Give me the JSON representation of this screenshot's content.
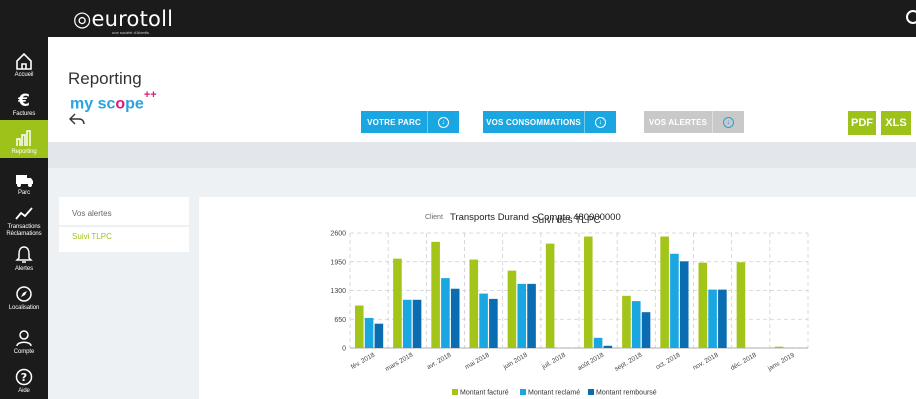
{
  "header": {
    "logo": "eurotoll",
    "logo_sub": "une société d'Abertis"
  },
  "sidebar": {
    "items": [
      {
        "label": "Accueil",
        "icon": "home-icon"
      },
      {
        "label": "Factures",
        "icon": "euro-icon"
      },
      {
        "label": "Reporting",
        "icon": "bar-chart-icon"
      },
      {
        "label": "Parc",
        "icon": "truck-icon"
      },
      {
        "label": "Transactions Réclamations",
        "icon": "trend-line-icon"
      },
      {
        "label": "Alertes",
        "icon": "bell-icon"
      },
      {
        "label": "Localisation",
        "icon": "compass-icon"
      },
      {
        "label": "Compte",
        "icon": "user-icon"
      },
      {
        "label": "Aide",
        "icon": "help-icon"
      }
    ],
    "active_index": 2
  },
  "page": {
    "title": "Reporting",
    "brand_a": "my sc",
    "brand_o": "o",
    "brand_b": "pe",
    "brand_plus": "++"
  },
  "tabs": {
    "parc": "VOTRE PARC",
    "conso": "VOS CONSOMMATIONS",
    "alertes": "VOS ALERTES"
  },
  "export": {
    "pdf": "PDF",
    "xls": "XLS"
  },
  "left_menu": {
    "item1": "Vos alertes",
    "item2": "Suivi TLPC"
  },
  "client": {
    "label": "Client",
    "value": "Transports Durand - Compte 480000000"
  },
  "colors": {
    "green": "#9dc31b",
    "blue": "#1aa6e0",
    "dark_blue": "#0a6db1",
    "dark": "#1b1b1b"
  },
  "chart_data": {
    "type": "bar",
    "title": "Suivi des TLPC",
    "categories": [
      "fév. 2018",
      "mars 2018",
      "avr. 2018",
      "mai 2018",
      "juin 2018",
      "juil. 2018",
      "août 2018",
      "sept. 2018",
      "oct. 2018",
      "nov. 2018",
      "déc. 2018",
      "janv. 2019"
    ],
    "series": [
      {
        "name": "Montant facturé",
        "color": "#a3c51a",
        "values": [
          960,
          2020,
          2400,
          2000,
          1750,
          2360,
          2520,
          1180,
          2520,
          1930,
          1940,
          30
        ]
      },
      {
        "name": "Montant reclamé",
        "color": "#1aa6e0",
        "values": [
          680,
          1090,
          1580,
          1230,
          1450,
          0,
          230,
          1060,
          2130,
          1320,
          0,
          0
        ]
      },
      {
        "name": "Montant remboursé",
        "color": "#0a6db1",
        "values": [
          550,
          1090,
          1340,
          1110,
          1450,
          0,
          50,
          810,
          1960,
          1320,
          0,
          0
        ]
      }
    ],
    "yticks": [
      "0",
      "650",
      "1300",
      "1950",
      "2600"
    ],
    "ylim": [
      0,
      2600
    ],
    "grid": true,
    "legend": "bottom"
  }
}
